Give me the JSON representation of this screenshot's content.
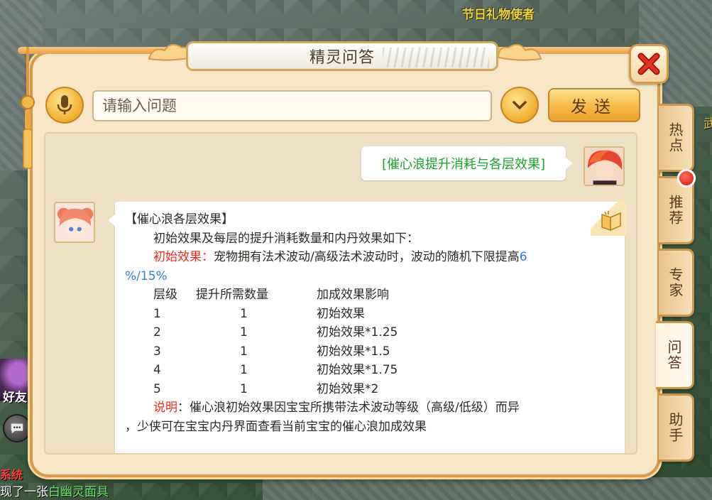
{
  "npc_name": "节日礼物使者",
  "hud": {
    "friend_label": "好友",
    "system_label": "系统",
    "system_message_prefix": "现了一张",
    "system_message_item": "白幽灵面具",
    "edge_text": "武"
  },
  "dialog": {
    "title": "精灵问答",
    "input_placeholder": "请输入问题",
    "send_label": "发送"
  },
  "chat": {
    "user_question": "[催心浪提升消耗与各层效果]",
    "answer": {
      "heading": "【催心浪各层效果】",
      "intro": "初始效果及每层的提升消耗数量和内丹效果如下：",
      "initial_label": "初始效果：",
      "initial_text": "宠物拥有法术波动/高级法术波动时，波动的随机下限提高",
      "initial_value_a": "6",
      "initial_value_b": "%/15%",
      "table_headers": [
        "层级",
        "提升所需数量",
        "加成效果影响"
      ],
      "table_rows": [
        [
          "1",
          "1",
          "初始效果"
        ],
        [
          "2",
          "1",
          "初始效果*1.25"
        ],
        [
          "3",
          "1",
          "初始效果*1.5"
        ],
        [
          "4",
          "1",
          "初始效果*1.75"
        ],
        [
          "5",
          "1",
          "初始效果*2"
        ]
      ],
      "note_label": "说明",
      "note_text_1": "：催心浪初始效果因宝宝所携带法术波动等级（高级/低级）而异",
      "note_text_2": "，少侠可在宝宝内丹界面查看当前宝宝的催心浪加成效果"
    }
  },
  "side_tabs": [
    "热点",
    "推荐",
    "专家",
    "问答",
    "助手"
  ],
  "active_tab": "问答",
  "colors": {
    "accent_gold": "#f2b63b",
    "frame": "#d59a4d",
    "highlight_red": "#ee2a1e",
    "highlight_blue": "#2f7cdc",
    "question_green": "#18a32a"
  }
}
